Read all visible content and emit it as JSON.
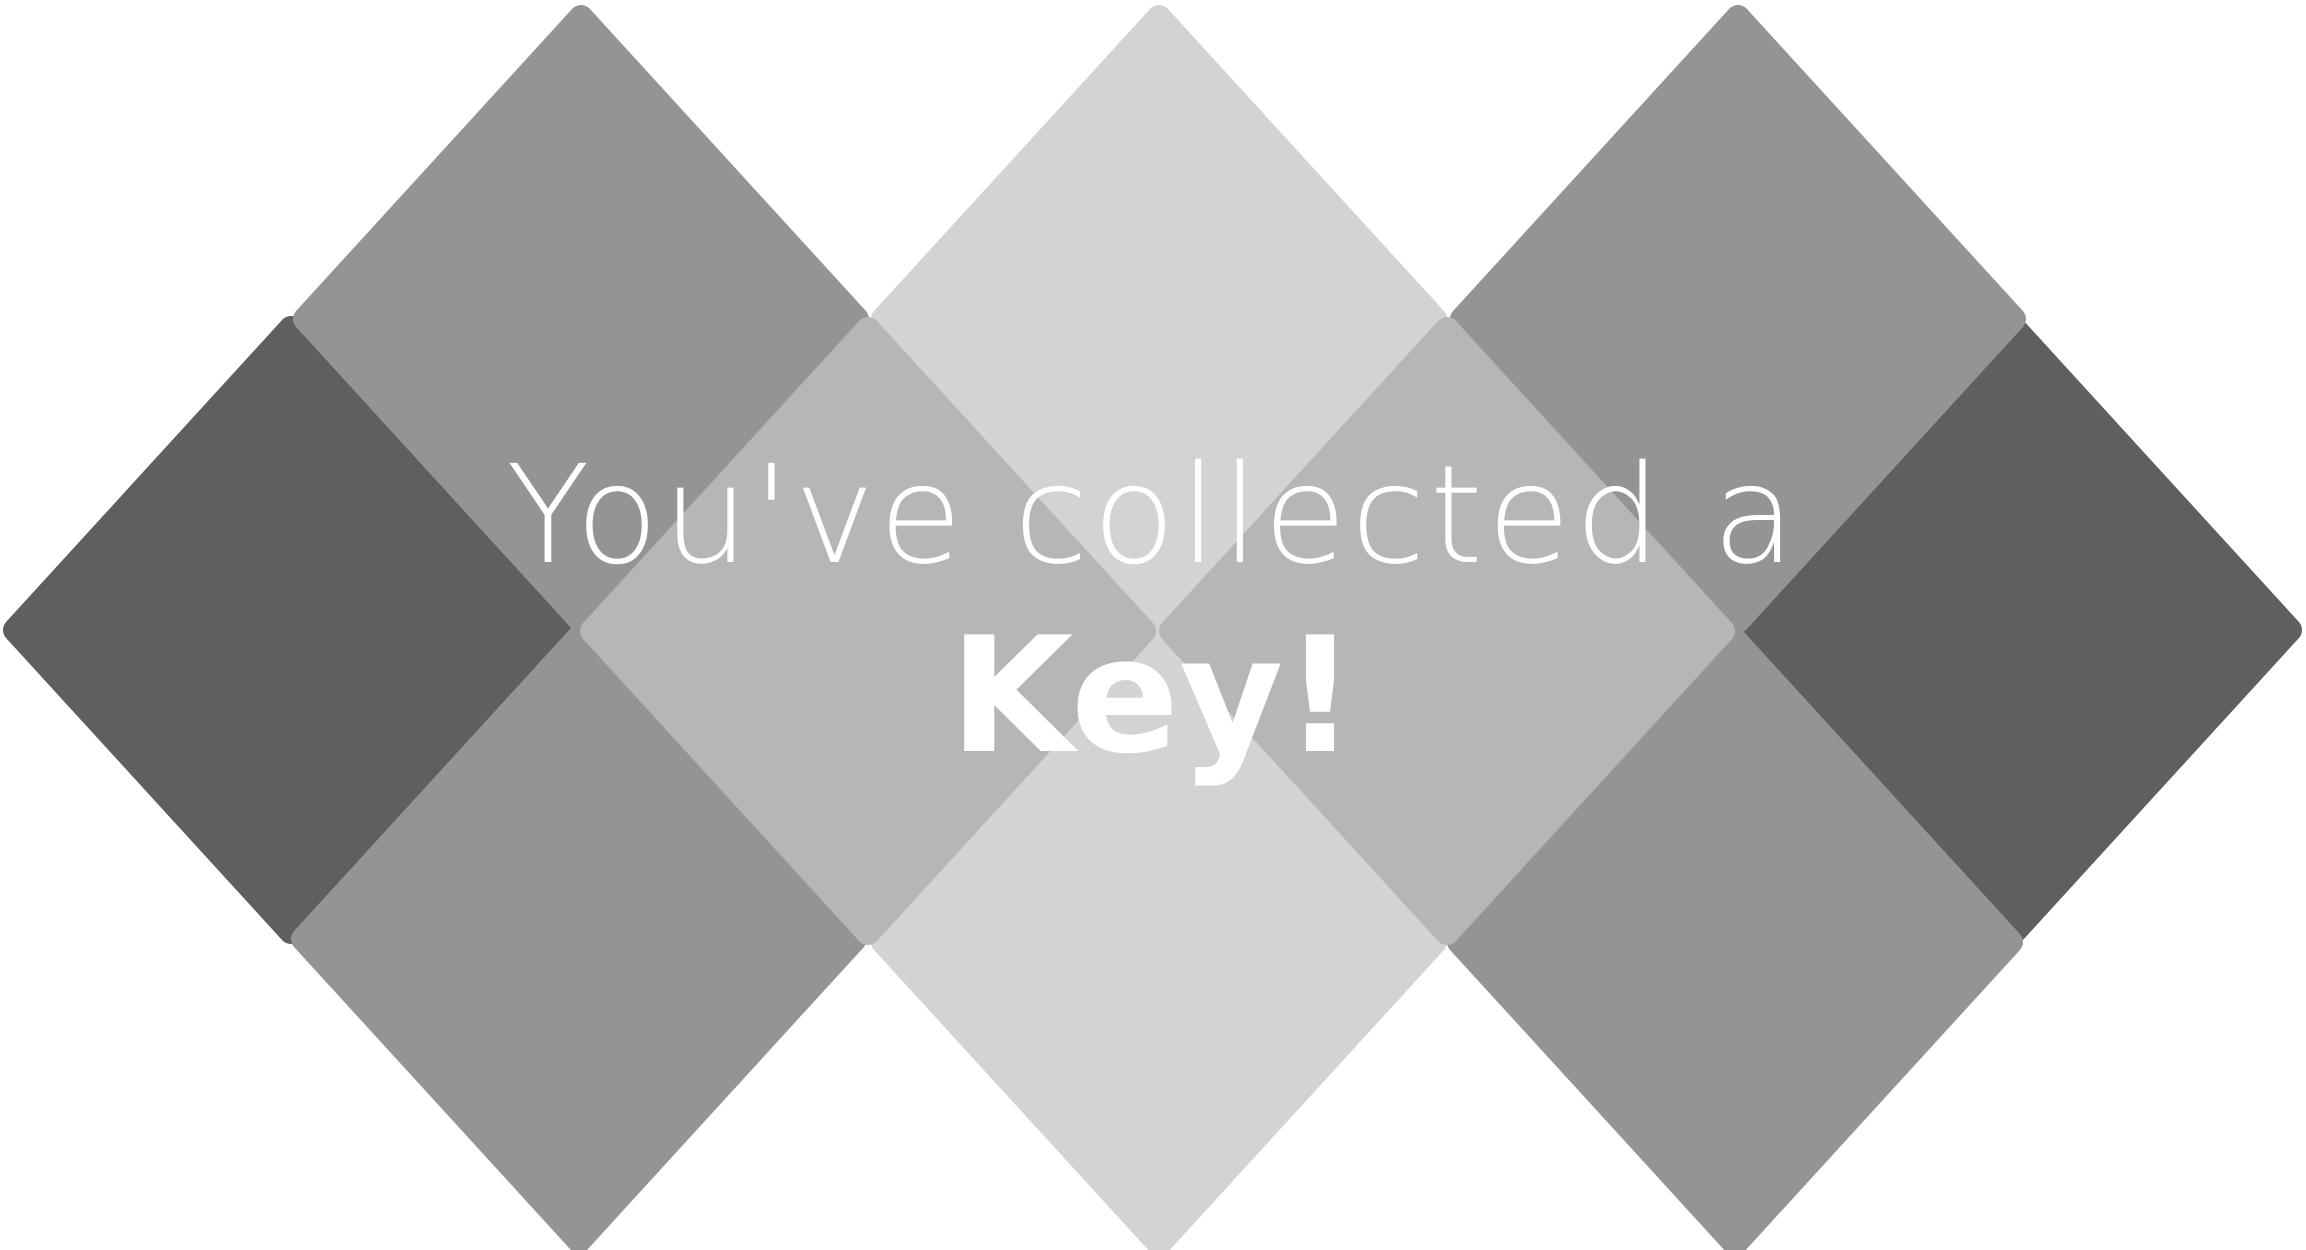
{
  "message": {
    "line1": "You've collected a",
    "line2": "Key!"
  },
  "colors": {
    "background": "#ffffff",
    "tile_dark": "#5f5f5f",
    "tile_mid": "#949494",
    "tile_light": "#d3d3d3",
    "tile_center": "#b6b6b6",
    "text": "#ffffff"
  }
}
